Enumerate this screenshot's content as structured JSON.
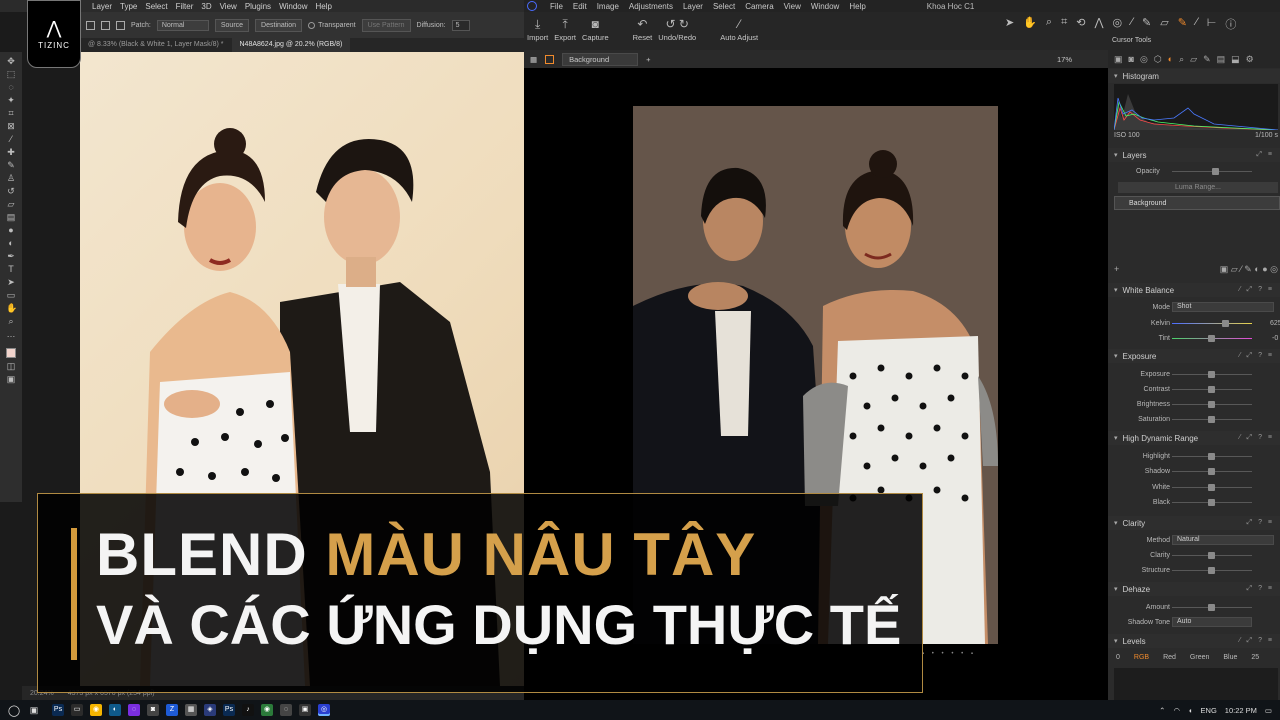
{
  "logo": {
    "brand": "TIZINC"
  },
  "photoshop": {
    "menu": [
      "Layer",
      "Type",
      "Select",
      "Filter",
      "3D",
      "View",
      "Plugins",
      "Window",
      "Help"
    ],
    "options": {
      "patch_label": "Patch:",
      "patch_value": "Normal",
      "source_label": "Source",
      "destination_label": "Destination",
      "transparent_label": "Transparent",
      "use_pattern_label": "Use Pattern",
      "diffusion_label": "Diffusion:",
      "diffusion_value": "5"
    },
    "tabs": [
      {
        "label": "@ 8.33% (Black & White 1, Layer Mask/8) *"
      },
      {
        "label": "N48A8624.jpg @ 20.2% (RGB/8)"
      }
    ],
    "status": {
      "zoom": "20.24%",
      "size": "4373 px x 6570 px (254 ppi)"
    }
  },
  "captureone": {
    "menu": [
      "File",
      "Edit",
      "Image",
      "Adjustments",
      "Layer",
      "Select",
      "Camera",
      "View",
      "Window",
      "Help"
    ],
    "window_title": "Khoa Hoc C1",
    "toolbar": [
      "Import",
      "Export",
      "Capture",
      "Reset",
      "Undo/Redo",
      "Auto Adjust"
    ],
    "cursor_tools_label": "Cursor Tools",
    "viewer": {
      "layer": "Background",
      "zoom": "17%"
    },
    "histogram": {
      "title": "Histogram",
      "iso": "ISO 100",
      "shutter": "1/100 s"
    },
    "layers": {
      "title": "Layers",
      "opacity_label": "Opacity",
      "luma_button": "Luma Range...",
      "background_layer": "Background"
    },
    "white_balance": {
      "title": "White Balance",
      "mode_label": "Mode",
      "mode_value": "Shot",
      "kelvin_label": "Kelvin",
      "kelvin_value": "625",
      "tint_label": "Tint",
      "tint_value": "-0"
    },
    "exposure": {
      "title": "Exposure",
      "items": [
        "Exposure",
        "Contrast",
        "Brightness",
        "Saturation"
      ]
    },
    "hdr": {
      "title": "High Dynamic Range",
      "items": [
        "Highlight",
        "Shadow",
        "White",
        "Black"
      ]
    },
    "clarity": {
      "title": "Clarity",
      "method_label": "Method",
      "method_value": "Natural",
      "items": [
        "Clarity",
        "Structure"
      ]
    },
    "dehaze": {
      "title": "Dehaze",
      "amount_label": "Amount",
      "shadow_tone_label": "Shadow Tone",
      "shadow_tone_value": "Auto"
    },
    "levels": {
      "title": "Levels",
      "left_value": "0",
      "tabs": [
        "RGB",
        "Red",
        "Green",
        "Blue"
      ],
      "right_value": "25"
    }
  },
  "title": {
    "line1_white": "BLEND",
    "line1_gold": "MÀU NÂU TÂY",
    "line2": "VÀ CÁC ỨNG DỤNG THỰC TẾ"
  },
  "taskbar": {
    "lang": "ENG",
    "time": "10:22 PM"
  },
  "colors": {
    "accent_gold": "#d5a04b",
    "c1_orange": "#f08a2c"
  }
}
